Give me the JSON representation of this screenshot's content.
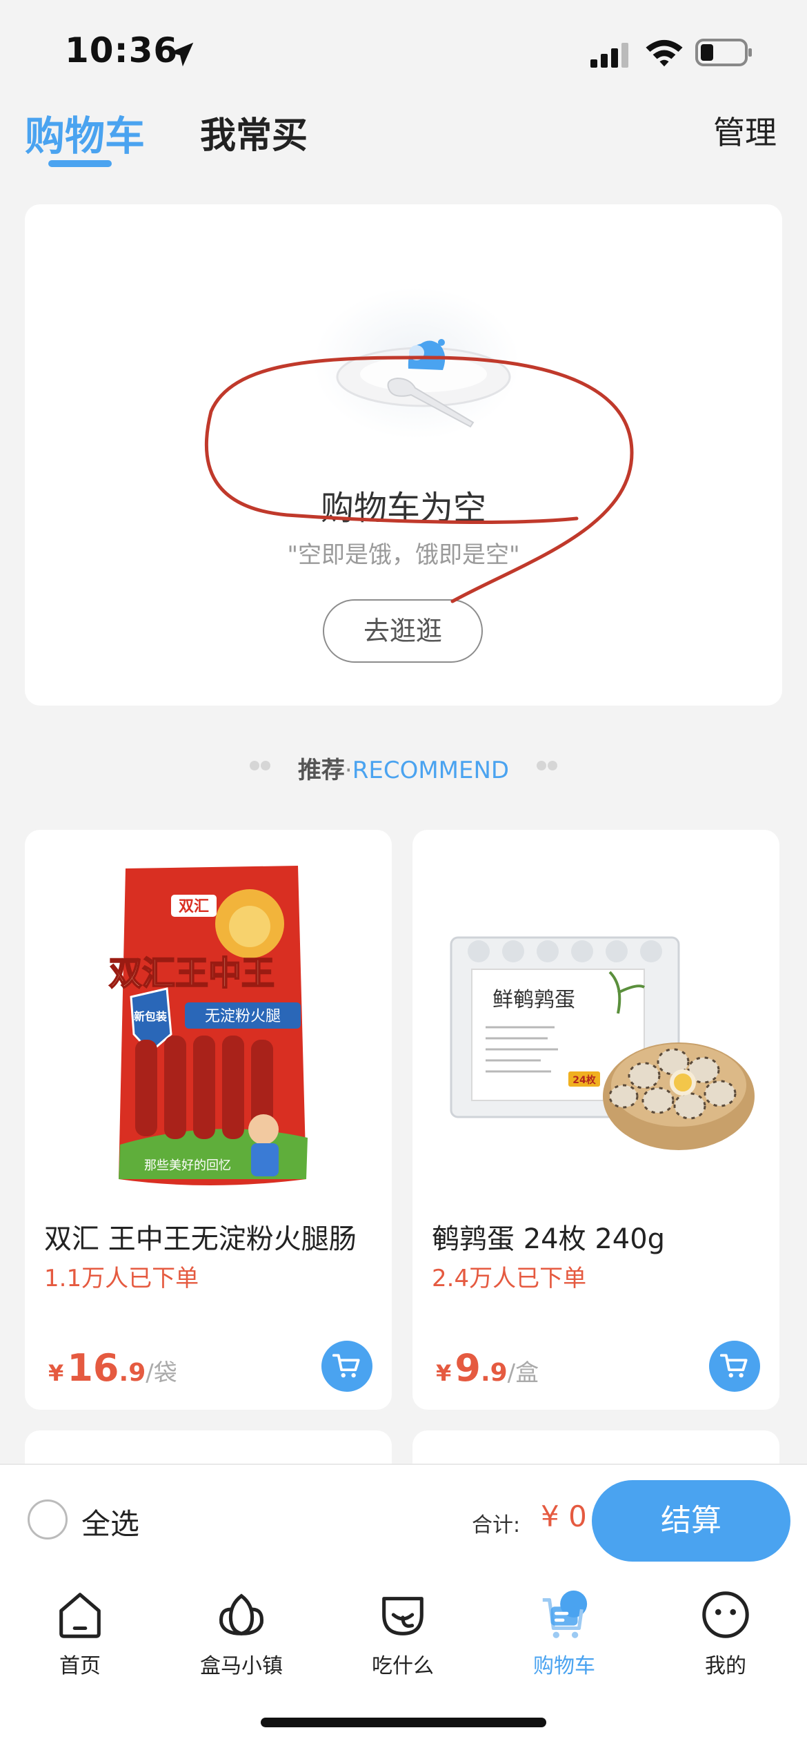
{
  "status_bar": {
    "time": "10:36",
    "icons": [
      "location-arrow-icon",
      "cellular-signal-icon",
      "wifi-icon",
      "battery-icon"
    ]
  },
  "header": {
    "tabs": [
      {
        "label": "购物车",
        "active": true
      },
      {
        "label": "我常买",
        "active": false
      }
    ],
    "manage_label": "管理"
  },
  "empty_cart": {
    "title": "购物车为空",
    "subtitle": "\"空即是饿，饿即是空\"",
    "button_label": "去逛逛"
  },
  "recommend": {
    "label_cn": "推荐",
    "separator": "·",
    "label_en": "RECOMMEND"
  },
  "products": [
    {
      "name": "双汇 王中王无淀粉火腿肠",
      "sales": "1.1万人已下单",
      "currency": "¥",
      "price_int": "16",
      "price_dec": ".9",
      "unit": "/袋",
      "package_brand": "双汇",
      "package_title": "双汇王中王",
      "package_tag": "无淀粉火腿",
      "package_badge": "新包装",
      "package_slogan": "那些美好的回忆"
    },
    {
      "name": "鹌鹑蛋 24枚 240g",
      "sales": "2.4万人已下单",
      "currency": "¥",
      "price_int": "9",
      "price_dec": ".9",
      "unit": "/盒",
      "package_title": "鲜鹌鹑蛋",
      "package_count": "24枚"
    }
  ],
  "checkout": {
    "select_all_label": "全选",
    "total_label": "合计:",
    "total_value": "¥ 0",
    "checkout_label": "结算"
  },
  "bottom_nav": {
    "items": [
      {
        "label": "首页",
        "icon": "home-icon",
        "active": false
      },
      {
        "label": "盒马小镇",
        "icon": "flower-icon",
        "active": false
      },
      {
        "label": "吃什么",
        "icon": "bowl-icon",
        "active": false
      },
      {
        "label": "购物车",
        "icon": "cart-icon",
        "active": true
      },
      {
        "label": "我的",
        "icon": "smiley-face-icon",
        "active": false
      }
    ]
  },
  "colors": {
    "accent": "#4aa3f0",
    "price": "#e55a40",
    "background": "#f3f3f3",
    "annotation": "#c0392b"
  }
}
